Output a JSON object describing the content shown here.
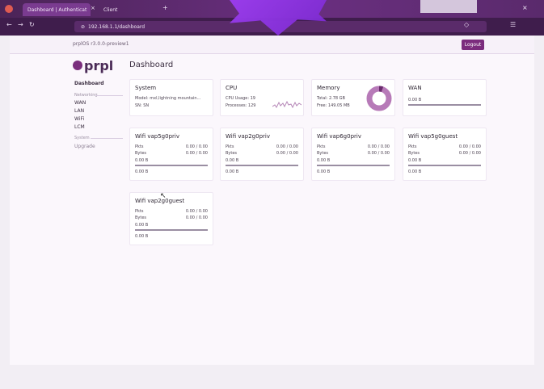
{
  "browser": {
    "tabs": [
      {
        "label": "Dashboard | Authenticat"
      },
      {
        "label": "Client"
      }
    ],
    "url": "192.168.1.1/dashboard"
  },
  "app": {
    "version": "prplOS r3.0.0-preview1",
    "logout_label": "Logout",
    "logo": "prpl"
  },
  "sidebar": {
    "items": [
      {
        "label": "Dashboard"
      },
      {
        "label": "Networking",
        "heading": true
      },
      {
        "label": "WAN"
      },
      {
        "label": "LAN"
      },
      {
        "label": "WiFi"
      },
      {
        "label": "LCM"
      },
      {
        "label": "System",
        "heading": true
      },
      {
        "label": "Upgrade"
      }
    ]
  },
  "main": {
    "title": "Dashboard",
    "cards": [
      {
        "title": "System",
        "lines": [
          "Model: mxl,lightning mountain...",
          "SN: SN"
        ]
      },
      {
        "title": "CPU",
        "lines": [
          "CPU Usage: 19",
          "Processes: 129"
        ]
      },
      {
        "title": "Memory",
        "lines": [
          "Total: 2.78 GB",
          "Free: 149.05 MB"
        ]
      },
      {
        "title": "WAN",
        "lines": [
          "0.00 B"
        ]
      },
      {
        "title": "Wifi vap5g0priv",
        "rows": [
          [
            "Pkts",
            "0.00 / 0.00"
          ],
          [
            "Bytes",
            "0.00 / 0.00"
          ]
        ],
        "sub": [
          "0.00 B",
          "0.00 B"
        ]
      },
      {
        "title": "Wifi vap2g0priv",
        "rows": [
          [
            "Pkts",
            "0.00 / 0.00"
          ],
          [
            "Bytes",
            "0.00 / 0.00"
          ]
        ],
        "sub": [
          "0.00 B",
          "0.00 B"
        ]
      },
      {
        "title": "Wifi vap6g0priv",
        "rows": [
          [
            "Pkts",
            "0.00 / 0.00"
          ],
          [
            "Bytes",
            "0.00 / 0.00"
          ]
        ],
        "sub": [
          "0.00 B",
          "0.00 B"
        ]
      },
      {
        "title": "Wifi vap5g0guest",
        "rows": [
          [
            "Pkts",
            "0.00 / 0.00"
          ],
          [
            "Bytes",
            "0.00 / 0.00"
          ]
        ],
        "sub": [
          "0.00 B",
          "0.00 B"
        ]
      },
      {
        "title": "Wifi vap2g0guest",
        "rows": [
          [
            "Pkts",
            "0.00 / 0.00"
          ],
          [
            "Bytes",
            "0.00 / 0.00"
          ]
        ],
        "sub": [
          "0.00 B",
          "0.00 B"
        ]
      }
    ]
  },
  "colors": {
    "accent": "#7b2c7d",
    "memory_ring": "#b77ab8"
  }
}
